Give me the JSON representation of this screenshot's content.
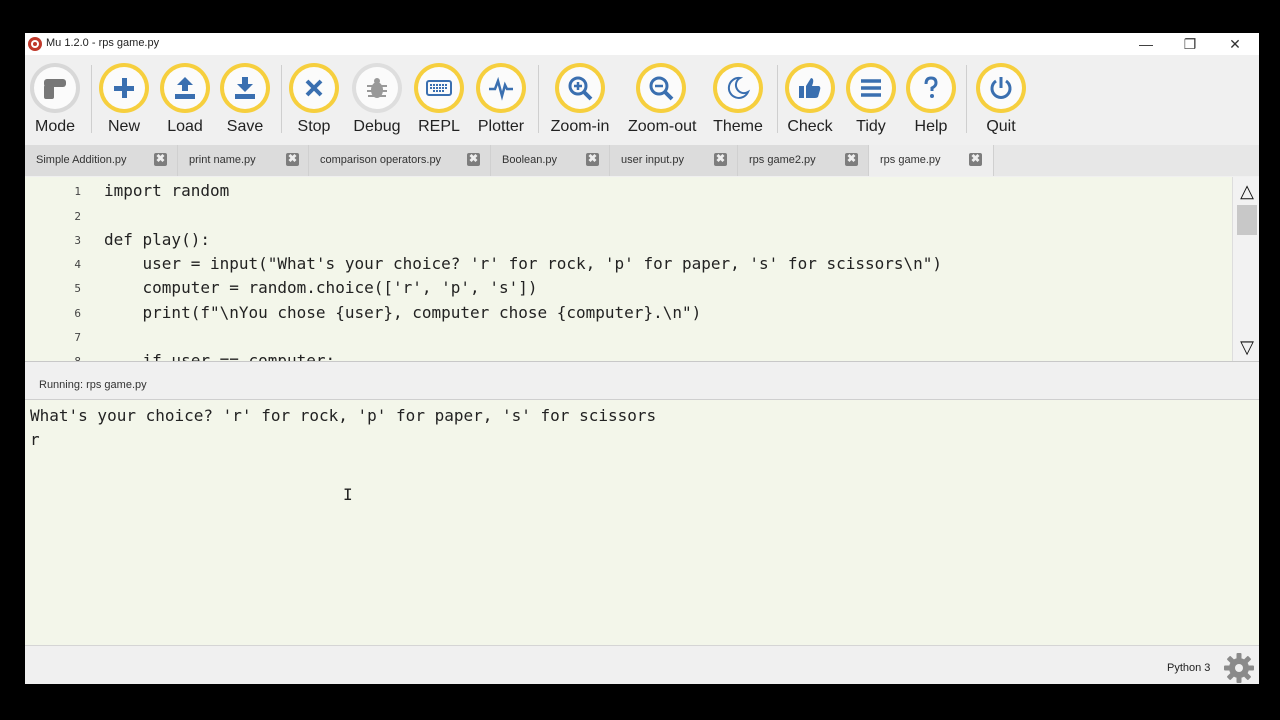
{
  "window": {
    "title": "Mu 1.2.0 - rps game.py"
  },
  "controls": {
    "minimize": "—",
    "maximize": "❐",
    "close": "✕"
  },
  "toolbar": [
    {
      "label": "Mode",
      "icon": "mode-icon"
    },
    {
      "label": "New",
      "icon": "plus-icon"
    },
    {
      "label": "Load",
      "icon": "upload-icon"
    },
    {
      "label": "Save",
      "icon": "download-icon"
    },
    {
      "label": "Stop",
      "icon": "close-icon"
    },
    {
      "label": "Debug",
      "icon": "bug-icon"
    },
    {
      "label": "REPL",
      "icon": "keyboard-icon"
    },
    {
      "label": "Plotter",
      "icon": "pulse-icon"
    },
    {
      "label": "Zoom-in",
      "icon": "zoom-in-icon"
    },
    {
      "label": "Zoom-out",
      "icon": "zoom-out-icon"
    },
    {
      "label": "Theme",
      "icon": "moon-icon"
    },
    {
      "label": "Check",
      "icon": "thumbs-up-icon"
    },
    {
      "label": "Tidy",
      "icon": "lines-icon"
    },
    {
      "label": "Help",
      "icon": "question-icon"
    },
    {
      "label": "Quit",
      "icon": "power-icon"
    }
  ],
  "tabs": [
    {
      "label": "Simple Addition.py"
    },
    {
      "label": "print name.py"
    },
    {
      "label": "comparison operators.py"
    },
    {
      "label": "Boolean.py"
    },
    {
      "label": "user input.py"
    },
    {
      "label": "rps game2.py"
    },
    {
      "label": "rps game.py",
      "active": true
    }
  ],
  "tab_close": "✖",
  "editor": {
    "line_numbers": [
      "1",
      "2",
      "3",
      "4",
      "5",
      "6",
      "7",
      "8"
    ],
    "lines": [
      "import random",
      "",
      "def play():",
      "    user = input(\"What's your choice? 'r' for rock, 'p' for paper, 's' for scissors\\n\")",
      "    computer = random.choice(['r', 'p', 's'])",
      "    print(f\"\\nYou chose {user}, computer chose {computer}.\\n\")",
      "",
      "    if user == computer:"
    ]
  },
  "scroll": {
    "up": "△",
    "down": "▽"
  },
  "run_panel": {
    "label": "Running: rps game.py"
  },
  "console": {
    "lines": [
      "What's your choice? 'r' for rock, 'p' for paper, 's' for scissors",
      "r"
    ],
    "cursor": "I"
  },
  "status": {
    "mode": "Python 3"
  },
  "colors": {
    "accent": "#f6cf3e",
    "editor_bg": "#f3f6ea"
  }
}
